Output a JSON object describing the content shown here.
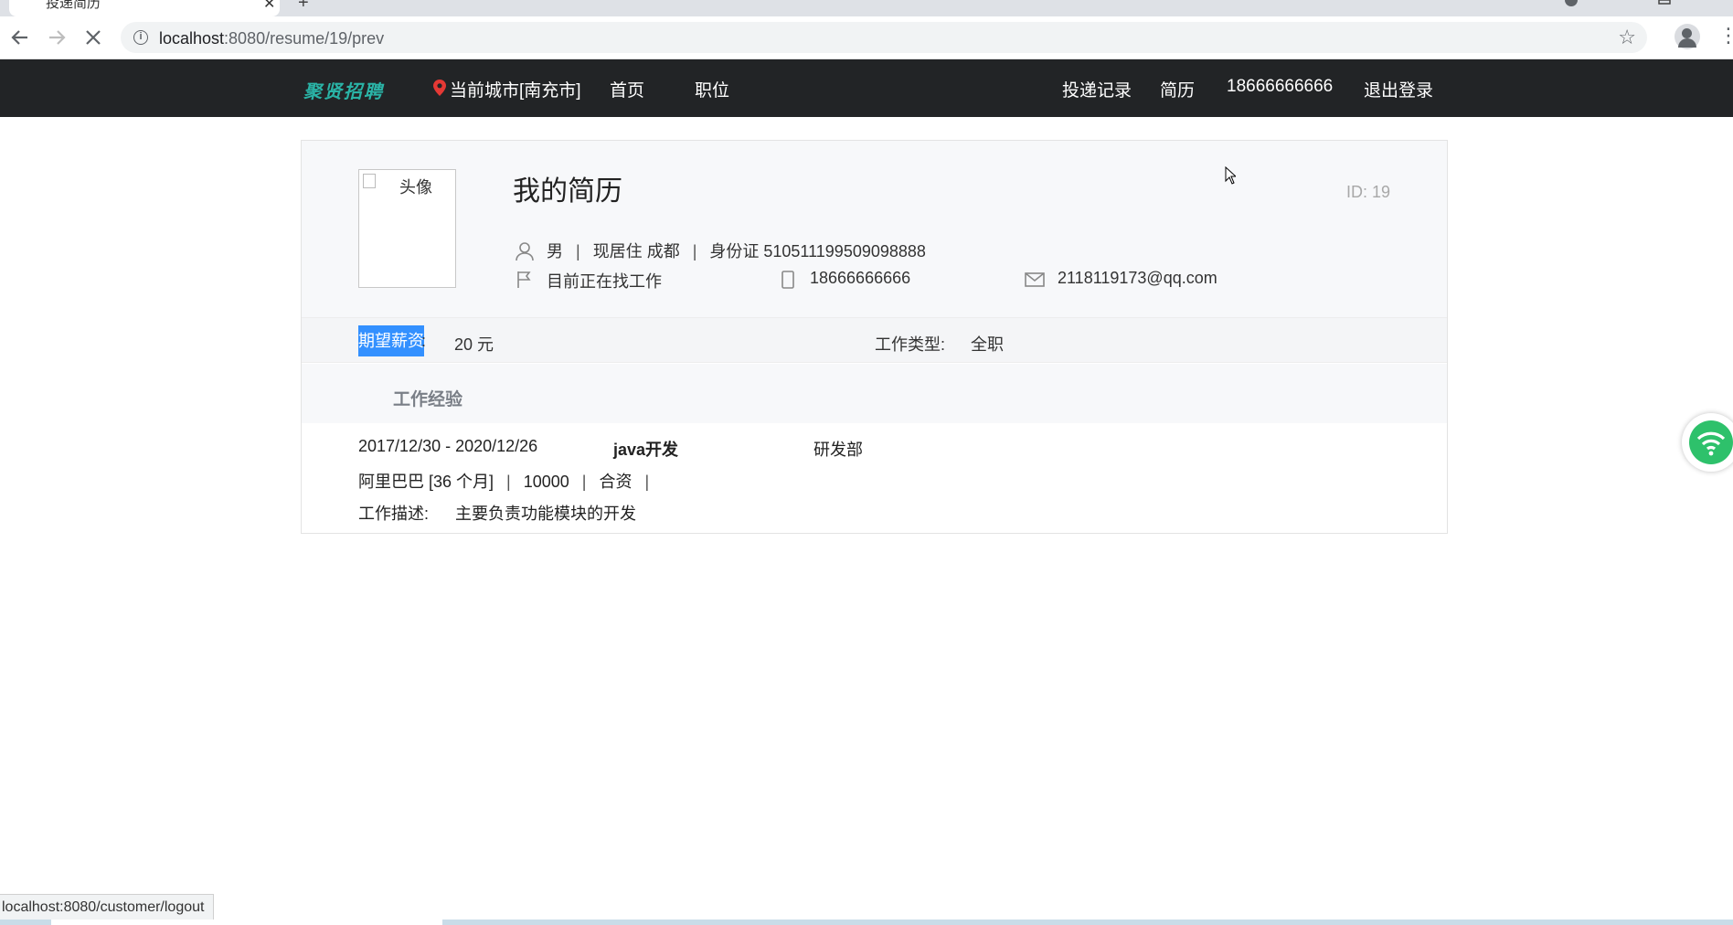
{
  "browser": {
    "tab_title": "投递简历",
    "url_host": "localhost",
    "url_path": ":8080/resume/19/prev",
    "status_url": "localhost:8080/customer/logout"
  },
  "nav": {
    "logo": "聚贤招聘",
    "city": "当前城市[南充市]",
    "home": "首页",
    "jobs": "职位",
    "records": "投递记录",
    "resume": "简历",
    "phone": "18666666666",
    "logout": "退出登录"
  },
  "resume": {
    "avatar_alt": "头像",
    "title": "我的简历",
    "id": "ID: 19",
    "gender": "男",
    "residence": "现居住 成都",
    "id_card": "身份证 510511199509098888",
    "status": "目前正在找工作",
    "phone": "18666666666",
    "email": "2118119173@qq.com",
    "salary_label": "期望薪资",
    "salary_colon": ":",
    "salary_value": "20 元",
    "worktype_label": "工作类型:",
    "worktype_value": "全职"
  },
  "experience": {
    "section_title": "工作经验",
    "period": "2017/12/30 - 2020/12/26",
    "position": "java开发",
    "department": "研发部",
    "company": "阿里巴巴 [36 个月]",
    "salary": "10000",
    "company_type": "合资",
    "desc_label": "工作描述:",
    "desc": "主要负责功能模块的开发"
  },
  "colors": {
    "nav_bg": "#222426",
    "logo": "#2ab3a6",
    "selection": "#3390ff",
    "pin": "#e53935",
    "wifi": "#2ec16b"
  },
  "icons": [
    "info-icon",
    "star-icon",
    "profile-icon",
    "menu-icon",
    "location-pin-icon",
    "user-icon",
    "flag-icon",
    "phone-icon",
    "mail-icon",
    "wifi-icon",
    "reload-icon"
  ]
}
